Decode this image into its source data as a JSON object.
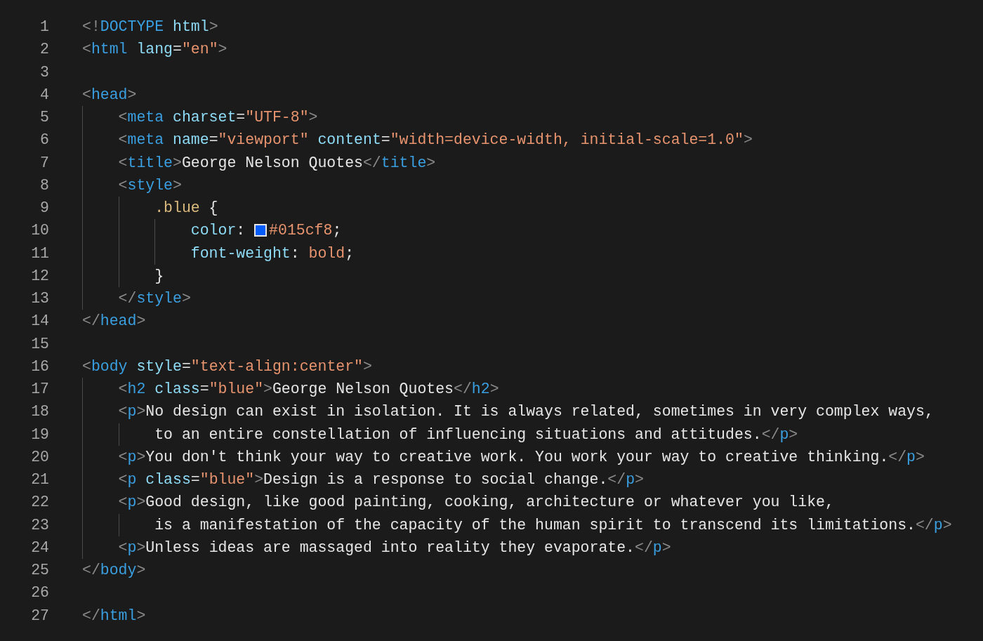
{
  "editor": {
    "lines": [
      {
        "number": "1",
        "tokens": [
          {
            "kind": "punct",
            "text": "<!"
          },
          {
            "kind": "tag",
            "text": "DOCTYPE"
          },
          {
            "kind": "attr",
            "text": " html"
          },
          {
            "kind": "punct",
            "text": ">"
          }
        ]
      },
      {
        "number": "2",
        "tokens": [
          {
            "kind": "punct",
            "text": "<"
          },
          {
            "kind": "tag",
            "text": "html"
          },
          {
            "kind": "attr",
            "text": " lang"
          },
          {
            "kind": "text",
            "text": "="
          },
          {
            "kind": "string",
            "text": "\"en\""
          },
          {
            "kind": "punct",
            "text": ">"
          }
        ]
      },
      {
        "number": "3"
      },
      {
        "number": "4",
        "tokens": [
          {
            "kind": "punct",
            "text": "<"
          },
          {
            "kind": "tag",
            "text": "head"
          },
          {
            "kind": "punct",
            "text": ">"
          }
        ]
      },
      {
        "number": "5",
        "tokens": [
          {
            "kind": "punct",
            "text": "    <"
          },
          {
            "kind": "tag",
            "text": "meta"
          },
          {
            "kind": "attr",
            "text": " charset"
          },
          {
            "kind": "text",
            "text": "="
          },
          {
            "kind": "string",
            "text": "\"UTF-8\""
          },
          {
            "kind": "punct",
            "text": ">"
          }
        ]
      },
      {
        "number": "6",
        "tokens": [
          {
            "kind": "punct",
            "text": "    <"
          },
          {
            "kind": "tag",
            "text": "meta"
          },
          {
            "kind": "attr",
            "text": " name"
          },
          {
            "kind": "text",
            "text": "="
          },
          {
            "kind": "string",
            "text": "\"viewport\""
          },
          {
            "kind": "attr",
            "text": " content"
          },
          {
            "kind": "text",
            "text": "="
          },
          {
            "kind": "string",
            "text": "\"width=device-width, initial-scale=1.0\""
          },
          {
            "kind": "punct",
            "text": ">"
          }
        ]
      },
      {
        "number": "7",
        "tokens": [
          {
            "kind": "punct",
            "text": "    <"
          },
          {
            "kind": "tag",
            "text": "title"
          },
          {
            "kind": "punct",
            "text": ">"
          },
          {
            "kind": "text",
            "text": "George Nelson Quotes"
          },
          {
            "kind": "punct",
            "text": "</"
          },
          {
            "kind": "tag",
            "text": "title"
          },
          {
            "kind": "punct",
            "text": ">"
          }
        ]
      },
      {
        "number": "8",
        "tokens": [
          {
            "kind": "punct",
            "text": "    <"
          },
          {
            "kind": "tag",
            "text": "style"
          },
          {
            "kind": "punct",
            "text": ">"
          }
        ]
      },
      {
        "number": "9",
        "tokens": [
          {
            "kind": "selector",
            "text": "        .blue"
          },
          {
            "kind": "text",
            "text": " {"
          }
        ]
      },
      {
        "number": "10",
        "tokens": [
          {
            "kind": "attr",
            "text": "            color"
          },
          {
            "kind": "text",
            "text": ": "
          },
          {
            "kind": "swatch",
            "color": "#015cf8"
          },
          {
            "kind": "string",
            "text": "#015cf8"
          },
          {
            "kind": "text",
            "text": ";"
          }
        ]
      },
      {
        "number": "11",
        "tokens": [
          {
            "kind": "attr",
            "text": "            font-weight"
          },
          {
            "kind": "text",
            "text": ": "
          },
          {
            "kind": "string",
            "text": "bold"
          },
          {
            "kind": "text",
            "text": ";"
          }
        ]
      },
      {
        "number": "12",
        "tokens": [
          {
            "kind": "text",
            "text": "        }"
          }
        ]
      },
      {
        "number": "13",
        "tokens": [
          {
            "kind": "punct",
            "text": "    </"
          },
          {
            "kind": "tag",
            "text": "style"
          },
          {
            "kind": "punct",
            "text": ">"
          }
        ]
      },
      {
        "number": "14",
        "tokens": [
          {
            "kind": "punct",
            "text": "</"
          },
          {
            "kind": "tag",
            "text": "head"
          },
          {
            "kind": "punct",
            "text": ">"
          }
        ]
      },
      {
        "number": "15"
      },
      {
        "number": "16",
        "tokens": [
          {
            "kind": "punct",
            "text": "<"
          },
          {
            "kind": "tag",
            "text": "body"
          },
          {
            "kind": "attr",
            "text": " style"
          },
          {
            "kind": "text",
            "text": "="
          },
          {
            "kind": "string",
            "text": "\"text-align:center\""
          },
          {
            "kind": "punct",
            "text": ">"
          }
        ]
      },
      {
        "number": "17",
        "tokens": [
          {
            "kind": "punct",
            "text": "    <"
          },
          {
            "kind": "tag",
            "text": "h2"
          },
          {
            "kind": "attr",
            "text": " class"
          },
          {
            "kind": "text",
            "text": "="
          },
          {
            "kind": "string",
            "text": "\"blue\""
          },
          {
            "kind": "punct",
            "text": ">"
          },
          {
            "kind": "text",
            "text": "George Nelson Quotes"
          },
          {
            "kind": "punct",
            "text": "</"
          },
          {
            "kind": "tag",
            "text": "h2"
          },
          {
            "kind": "punct",
            "text": ">"
          }
        ]
      },
      {
        "number": "18",
        "tokens": [
          {
            "kind": "punct",
            "text": "    <"
          },
          {
            "kind": "tag",
            "text": "p"
          },
          {
            "kind": "punct",
            "text": ">"
          },
          {
            "kind": "text",
            "text": "No design can exist in isolation. It is always related, sometimes in very complex ways,"
          }
        ]
      },
      {
        "number": "19",
        "tokens": [
          {
            "kind": "text",
            "text": "        to an entire constellation of influencing situations and attitudes."
          },
          {
            "kind": "punct",
            "text": "</"
          },
          {
            "kind": "tag",
            "text": "p"
          },
          {
            "kind": "punct",
            "text": ">"
          }
        ]
      },
      {
        "number": "20",
        "tokens": [
          {
            "kind": "punct",
            "text": "    <"
          },
          {
            "kind": "tag",
            "text": "p"
          },
          {
            "kind": "punct",
            "text": ">"
          },
          {
            "kind": "text",
            "text": "You don't think your way to creative work. You work your way to creative thinking."
          },
          {
            "kind": "punct",
            "text": "</"
          },
          {
            "kind": "tag",
            "text": "p"
          },
          {
            "kind": "punct",
            "text": ">"
          }
        ]
      },
      {
        "number": "21",
        "tokens": [
          {
            "kind": "punct",
            "text": "    <"
          },
          {
            "kind": "tag",
            "text": "p"
          },
          {
            "kind": "attr",
            "text": " class"
          },
          {
            "kind": "text",
            "text": "="
          },
          {
            "kind": "string",
            "text": "\"blue\""
          },
          {
            "kind": "punct",
            "text": ">"
          },
          {
            "kind": "text",
            "text": "Design is a response to social change."
          },
          {
            "kind": "punct",
            "text": "</"
          },
          {
            "kind": "tag",
            "text": "p"
          },
          {
            "kind": "punct",
            "text": ">"
          }
        ]
      },
      {
        "number": "22",
        "tokens": [
          {
            "kind": "punct",
            "text": "    <"
          },
          {
            "kind": "tag",
            "text": "p"
          },
          {
            "kind": "punct",
            "text": ">"
          },
          {
            "kind": "text",
            "text": "Good design, like good painting, cooking, architecture or whatever you like,"
          }
        ]
      },
      {
        "number": "23",
        "tokens": [
          {
            "kind": "text",
            "text": "        is a manifestation of the capacity of the human spirit to transcend its limitations."
          },
          {
            "kind": "punct",
            "text": "</"
          },
          {
            "kind": "tag",
            "text": "p"
          },
          {
            "kind": "punct",
            "text": ">"
          }
        ]
      },
      {
        "number": "24",
        "tokens": [
          {
            "kind": "punct",
            "text": "    <"
          },
          {
            "kind": "tag",
            "text": "p"
          },
          {
            "kind": "punct",
            "text": ">"
          },
          {
            "kind": "text",
            "text": "Unless ideas are massaged into reality they evaporate."
          },
          {
            "kind": "punct",
            "text": "</"
          },
          {
            "kind": "tag",
            "text": "p"
          },
          {
            "kind": "punct",
            "text": ">"
          }
        ]
      },
      {
        "number": "25",
        "tokens": [
          {
            "kind": "punct",
            "text": "</"
          },
          {
            "kind": "tag",
            "text": "body"
          },
          {
            "kind": "punct",
            "text": ">"
          }
        ]
      },
      {
        "number": "26"
      },
      {
        "number": "27",
        "tokens": [
          {
            "kind": "punct",
            "text": "</"
          },
          {
            "kind": "tag",
            "text": "html"
          },
          {
            "kind": "punct",
            "text": ">"
          }
        ]
      }
    ]
  }
}
